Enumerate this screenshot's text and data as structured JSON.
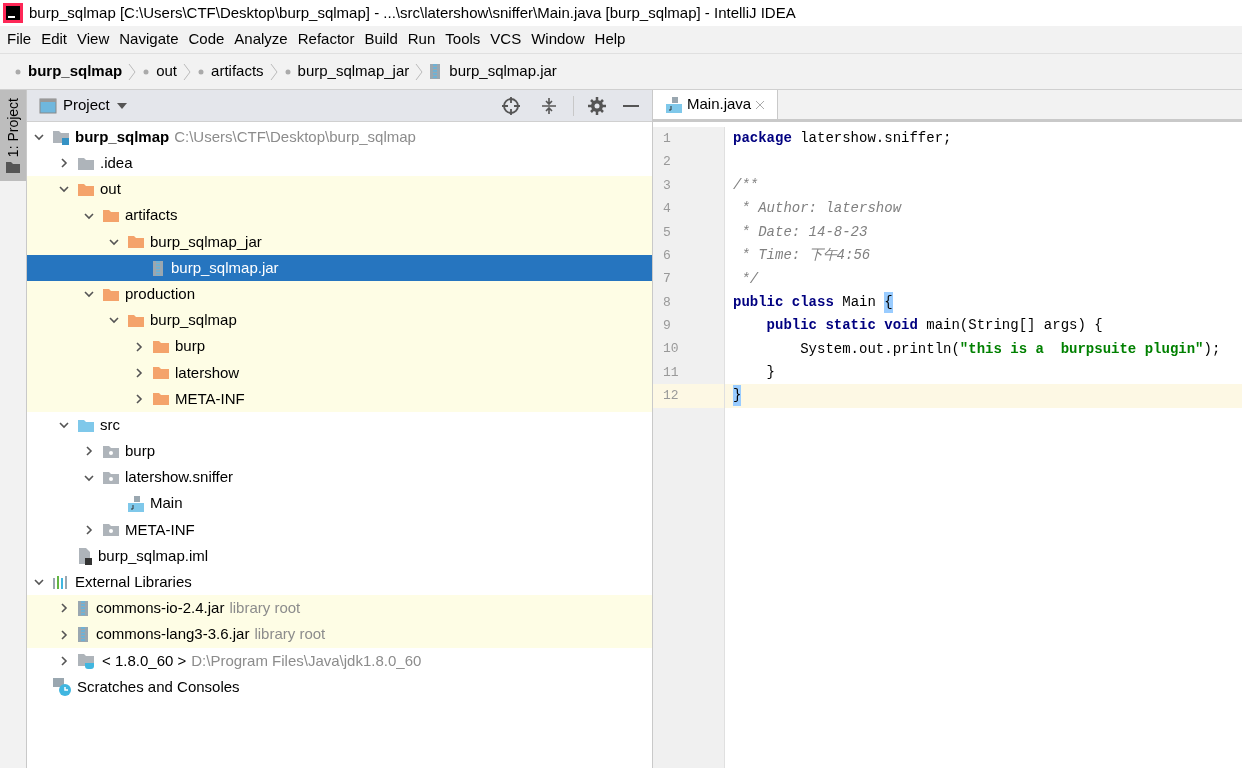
{
  "window": {
    "title": "burp_sqlmap [C:\\Users\\CTF\\Desktop\\burp_sqlmap] - ...\\src\\latershow\\sniffer\\Main.java [burp_sqlmap] - IntelliJ IDEA"
  },
  "menu": [
    "File",
    "Edit",
    "View",
    "Navigate",
    "Code",
    "Analyze",
    "Refactor",
    "Build",
    "Run",
    "Tools",
    "VCS",
    "Window",
    "Help"
  ],
  "breadcrumbs": [
    {
      "label": "burp_sqlmap",
      "kind": "module"
    },
    {
      "label": "out",
      "kind": "folder"
    },
    {
      "label": "artifacts",
      "kind": "folder"
    },
    {
      "label": "burp_sqlmap_jar",
      "kind": "folder"
    },
    {
      "label": "burp_sqlmap.jar",
      "kind": "jar"
    }
  ],
  "side_tab": {
    "label": "1: Project",
    "selected": true
  },
  "project_panel": {
    "title": "Project",
    "tree": [
      {
        "label": "burp_sqlmap",
        "hint": "C:\\Users\\CTF\\Desktop\\burp_sqlmap",
        "kind": "module",
        "expanded": true,
        "selected": false,
        "highlighted": false,
        "children": [
          {
            "label": ".idea",
            "kind": "folder-gray",
            "expanded": false,
            "selected": false,
            "highlighted": false
          },
          {
            "label": "out",
            "kind": "folder-orange",
            "expanded": true,
            "selected": false,
            "highlighted": true,
            "children": [
              {
                "label": "artifacts",
                "kind": "folder-orange",
                "expanded": true,
                "selected": false,
                "highlighted": true,
                "children": [
                  {
                    "label": "burp_sqlmap_jar",
                    "kind": "folder-orange",
                    "expanded": true,
                    "selected": false,
                    "highlighted": true,
                    "children": [
                      {
                        "label": "burp_sqlmap.jar",
                        "kind": "jar",
                        "selected": true
                      }
                    ]
                  }
                ]
              },
              {
                "label": "production",
                "kind": "folder-orange",
                "expanded": true,
                "selected": false,
                "highlighted": true,
                "children": [
                  {
                    "label": "burp_sqlmap",
                    "kind": "folder-orange",
                    "expanded": true,
                    "selected": false,
                    "highlighted": true,
                    "children": [
                      {
                        "label": "burp",
                        "kind": "folder-orange",
                        "expanded": false,
                        "selected": false,
                        "highlighted": true
                      },
                      {
                        "label": "latershow",
                        "kind": "folder-orange",
                        "expanded": false,
                        "selected": false,
                        "highlighted": true
                      },
                      {
                        "label": "META-INF",
                        "kind": "folder-orange",
                        "expanded": false,
                        "selected": false,
                        "highlighted": true
                      }
                    ]
                  }
                ]
              }
            ]
          },
          {
            "label": "src",
            "kind": "folder-blue",
            "expanded": true,
            "selected": false,
            "highlighted": false,
            "children": [
              {
                "label": "burp",
                "kind": "package",
                "expanded": false,
                "selected": false,
                "highlighted": false
              },
              {
                "label": "latershow.sniffer",
                "kind": "package",
                "expanded": true,
                "selected": false,
                "highlighted": false,
                "children": [
                  {
                    "label": "Main",
                    "kind": "class",
                    "selected": false,
                    "highlighted": false
                  }
                ]
              },
              {
                "label": "META-INF",
                "kind": "package",
                "expanded": false,
                "selected": false,
                "highlighted": false
              }
            ]
          },
          {
            "label": "burp_sqlmap.iml",
            "kind": "iml",
            "selected": false,
            "highlighted": false
          }
        ]
      },
      {
        "label": "External Libraries",
        "kind": "libraries",
        "expanded": true,
        "selected": false,
        "highlighted": false,
        "children": [
          {
            "label": "commons-io-2.4.jar",
            "hint": "library root",
            "kind": "jar",
            "expanded": false,
            "selected": false,
            "highlighted": true
          },
          {
            "label": "commons-lang3-3.6.jar",
            "hint": "library root",
            "kind": "jar",
            "expanded": false,
            "selected": false,
            "highlighted": true
          },
          {
            "label": "< 1.8.0_60 >",
            "hint": "D:\\Program Files\\Java\\jdk1.8.0_60",
            "kind": "jdk",
            "expanded": false,
            "selected": false,
            "highlighted": false
          }
        ]
      },
      {
        "label": "Scratches and Consoles",
        "kind": "scratches",
        "selected": false,
        "highlighted": false
      }
    ]
  },
  "editor": {
    "tabs": [
      {
        "label": "Main.java",
        "selected": true
      }
    ],
    "lines": [
      {
        "number": "1",
        "current": false,
        "tokens": [
          {
            "text": "package",
            "kind": "keyword"
          },
          {
            "text": " latershow.sniffer;",
            "kind": "plain"
          }
        ]
      },
      {
        "number": "2",
        "current": false
      },
      {
        "number": "3",
        "current": false,
        "tokens": [
          {
            "text": "/**",
            "kind": "comment"
          }
        ]
      },
      {
        "number": "4",
        "current": false,
        "tokens": [
          {
            "text": " * Author: latershow",
            "kind": "comment"
          }
        ]
      },
      {
        "number": "5",
        "current": false,
        "tokens": [
          {
            "text": " * Date: 14-8-23",
            "kind": "comment"
          }
        ]
      },
      {
        "number": "6",
        "current": false,
        "tokens": [
          {
            "text": " * Time: 下午4:56",
            "kind": "comment"
          }
        ]
      },
      {
        "number": "7",
        "current": false,
        "tokens": [
          {
            "text": " */",
            "kind": "comment"
          }
        ]
      },
      {
        "number": "8",
        "current": false,
        "tokens": [
          {
            "text": "public class",
            "kind": "keyword"
          },
          {
            "text": " Main ",
            "kind": "plain"
          },
          {
            "text": "{",
            "kind": "match"
          }
        ]
      },
      {
        "number": "9",
        "current": false,
        "tokens": [
          {
            "text": "    public static void",
            "kind": "keyword"
          },
          {
            "text": " main(String[] args) {",
            "kind": "plain"
          }
        ]
      },
      {
        "number": "10",
        "current": false,
        "tokens": [
          {
            "text": "        System.out.println(",
            "kind": "plain"
          },
          {
            "text": "\"this is a  burpsuite plugin\"",
            "kind": "string"
          },
          {
            "text": ");",
            "kind": "plain"
          }
        ]
      },
      {
        "number": "11",
        "current": false,
        "tokens": [
          {
            "text": "    }",
            "kind": "plain"
          }
        ]
      },
      {
        "number": "12",
        "current": true,
        "tokens": [
          {
            "text": "}",
            "kind": "match"
          }
        ]
      }
    ]
  }
}
